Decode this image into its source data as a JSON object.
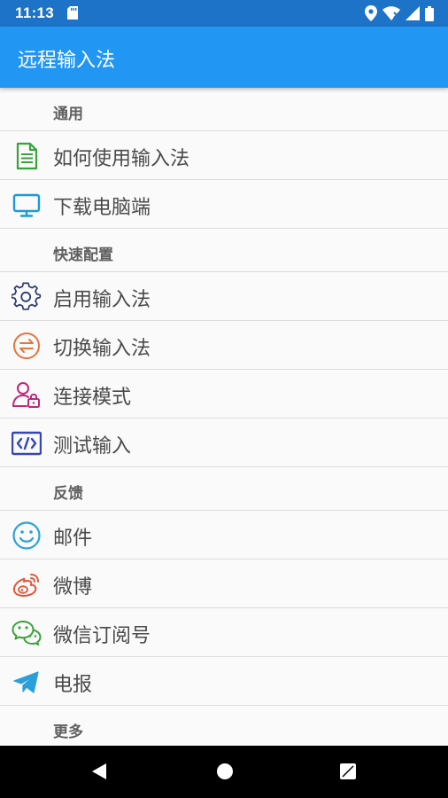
{
  "status_bar": {
    "time": "11:13"
  },
  "app_bar": {
    "title": "远程输入法"
  },
  "sections": {
    "general": {
      "header": "通用",
      "items": [
        {
          "label": "如何使用输入法",
          "icon": "document-icon"
        },
        {
          "label": "下载电脑端",
          "icon": "monitor-icon"
        }
      ]
    },
    "quick_config": {
      "header": "快速配置",
      "items": [
        {
          "label": "启用输入法",
          "icon": "gear-icon"
        },
        {
          "label": "切换输入法",
          "icon": "switch-icon"
        },
        {
          "label": "连接模式",
          "icon": "user-lock-icon"
        },
        {
          "label": "测试输入",
          "icon": "code-icon"
        }
      ]
    },
    "feedback": {
      "header": "反馈",
      "items": [
        {
          "label": "邮件",
          "icon": "smiley-icon"
        },
        {
          "label": "微博",
          "icon": "weibo-icon"
        },
        {
          "label": "微信订阅号",
          "icon": "wechat-icon"
        },
        {
          "label": "电报",
          "icon": "telegram-icon"
        }
      ]
    },
    "more": {
      "header": "更多"
    }
  },
  "colors": {
    "status_bar": "#1d73c7",
    "app_bar": "#2196f3",
    "background": "#fafafa",
    "divider": "#dcdcdc",
    "document_icon": "#3aa23a",
    "monitor_icon": "#1e9ad6",
    "gear_icon": "#2c3a6b",
    "switch_icon": "#e8743b",
    "user_lock_icon": "#c2267a",
    "code_icon": "#3446b8",
    "smiley_icon": "#2ba3d6",
    "weibo_icon": "#e0573a",
    "wechat_icon": "#3aa23a",
    "telegram_icon": "#2a9fd9"
  }
}
